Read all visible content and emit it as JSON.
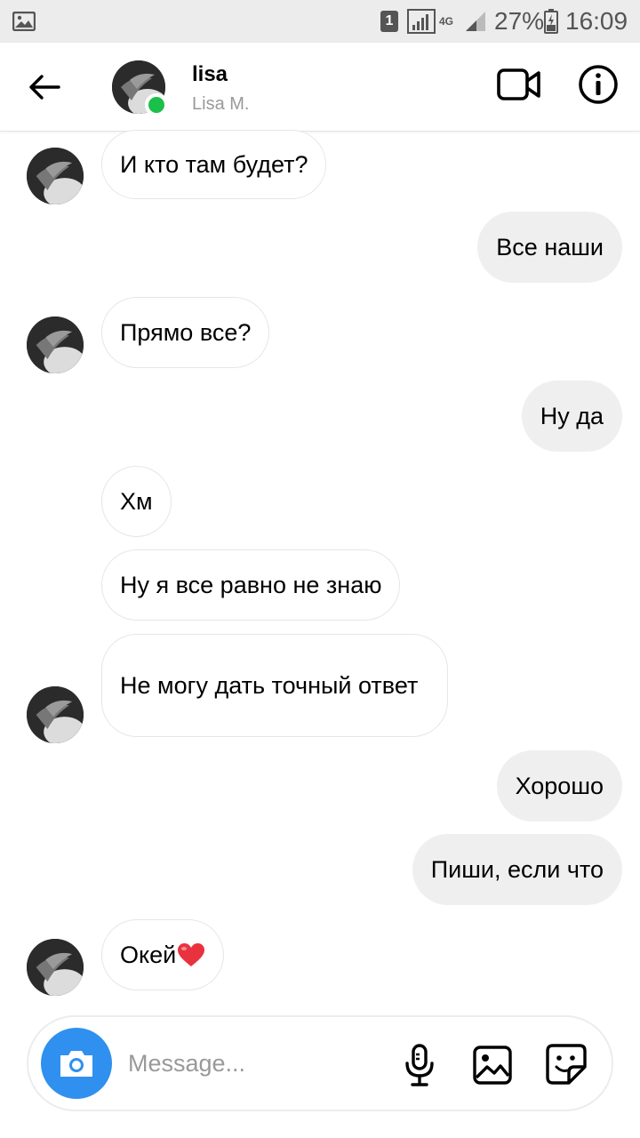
{
  "status_bar": {
    "sim_label": "1",
    "network": "4G",
    "battery_percent": "27%",
    "time": "16:09",
    "icons": [
      "gallery-icon",
      "sim-icon",
      "signal-icon",
      "battery-icon"
    ]
  },
  "header": {
    "name": "lisa",
    "subtitle": "Lisa M.",
    "online": true,
    "online_color": "#1bc04a",
    "icons": [
      "back-arrow-icon",
      "video-call-icon",
      "info-icon"
    ]
  },
  "messages": [
    {
      "side": "in",
      "text": "И кто там будет?",
      "avatar": true
    },
    {
      "side": "out",
      "text": "Все наши"
    },
    {
      "side": "in",
      "text": "Прямо все?",
      "avatar": true
    },
    {
      "side": "out",
      "text": "Ну да"
    },
    {
      "side": "in",
      "text": "Хм",
      "avatar": false
    },
    {
      "side": "in",
      "text": "Ну я все равно не знаю",
      "avatar": false
    },
    {
      "side": "in",
      "text": "Не могу дать точный ответ",
      "avatar": true
    },
    {
      "side": "out",
      "text": "Хорошо"
    },
    {
      "side": "out",
      "text": "Пиши, если что"
    },
    {
      "side": "in",
      "text": "Окей",
      "emoji": "heart-emoji",
      "avatar": true
    }
  ],
  "composer": {
    "placeholder": "Message...",
    "camera_color": "#2f90ef",
    "icons": [
      "camera-icon",
      "microphone-icon",
      "gallery-icon",
      "sticker-icon"
    ]
  },
  "colors": {
    "incoming_bubble": "#ffffff",
    "outgoing_bubble": "#efefef",
    "bubble_border": "#e6e6e6"
  }
}
